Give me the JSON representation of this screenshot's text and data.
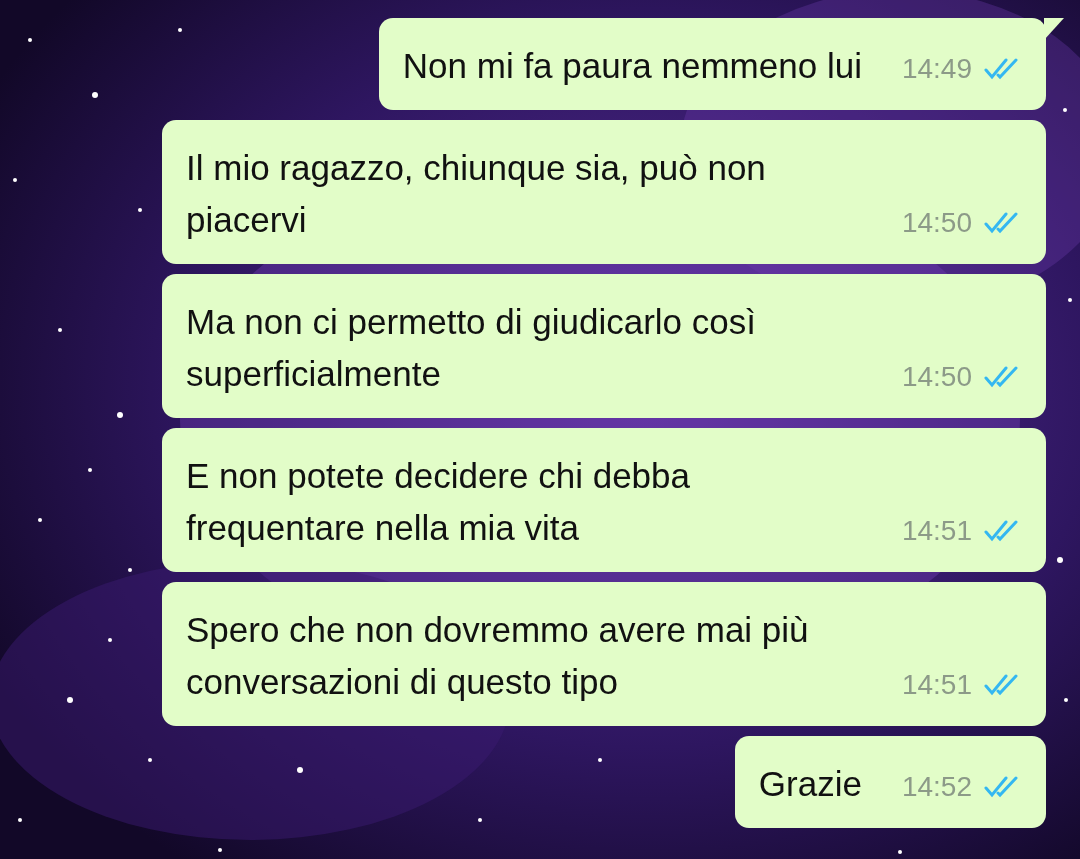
{
  "messages": [
    {
      "text": "Non mi fa paura nemmeno lui",
      "time": "14:49",
      "read": true,
      "tail": true
    },
    {
      "text": "Il mio ragazzo, chiunque sia, può non piacervi",
      "time": "14:50",
      "read": true,
      "tail": false
    },
    {
      "text": "Ma non ci permetto di giudicarlo così superficialmente",
      "time": "14:50",
      "read": true,
      "tail": false
    },
    {
      "text": "E non potete decidere chi debba frequentare nella mia vita",
      "time": "14:51",
      "read": true,
      "tail": false
    },
    {
      "text": "Spero che non dovremmo avere mai più conversazioni di questo tipo",
      "time": "14:51",
      "read": true,
      "tail": false
    },
    {
      "text": "Grazie",
      "time": "14:52",
      "read": true,
      "tail": false
    }
  ]
}
